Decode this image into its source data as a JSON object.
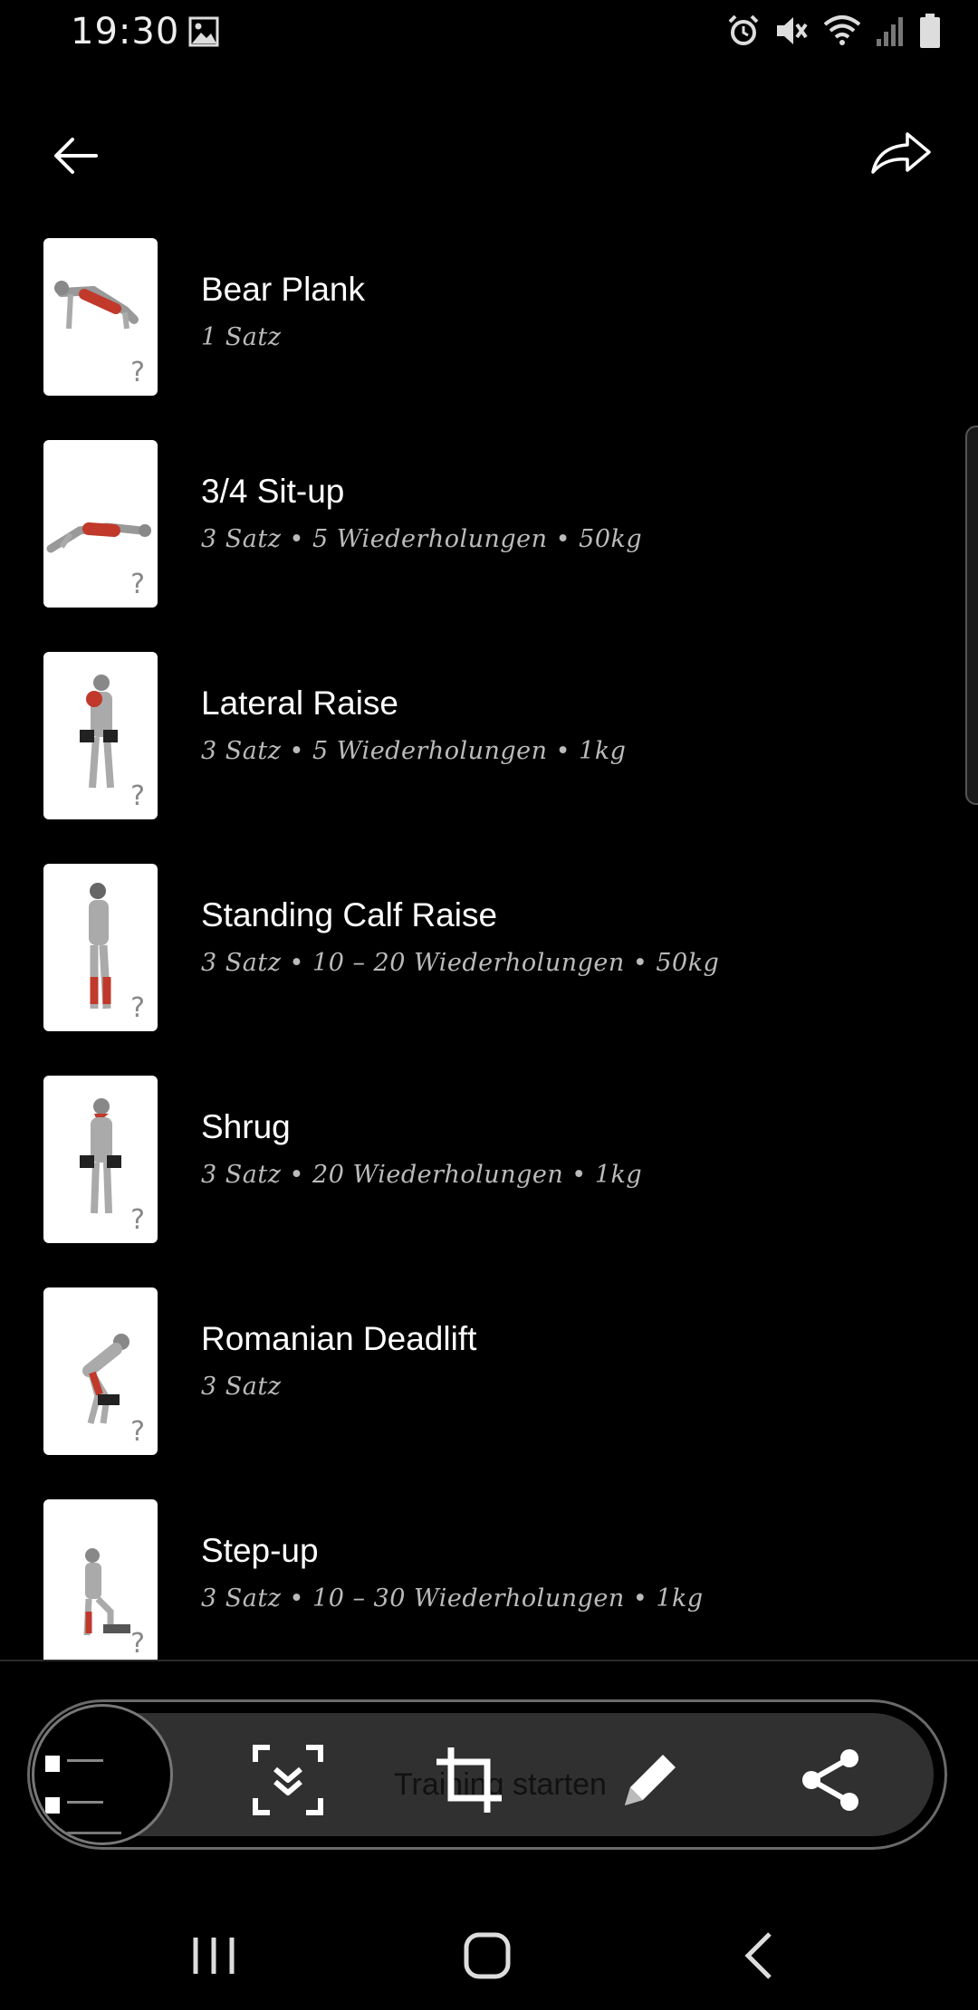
{
  "status_bar": {
    "time": "19:30",
    "icons": [
      "image-icon",
      "alarm-icon",
      "mute-icon",
      "wifi-icon",
      "signal-icon",
      "battery-icon"
    ]
  },
  "app_bar": {
    "back_icon": "arrow-left-icon",
    "share_icon": "share-forward-icon"
  },
  "exercises": [
    {
      "name": "Bear Plank",
      "details": "1 Satz"
    },
    {
      "name": "3/4 Sit-up",
      "details": "3 Satz • 5 Wiederholungen • 50kg"
    },
    {
      "name": "Lateral Raise",
      "details": "3 Satz • 5 Wiederholungen • 1kg"
    },
    {
      "name": "Standing Calf Raise",
      "details": "3 Satz • 10 – 20 Wiederholungen • 50kg"
    },
    {
      "name": "Shrug",
      "details": "3 Satz • 20 Wiederholungen • 1kg"
    },
    {
      "name": "Romanian Deadlift",
      "details": "3 Satz"
    },
    {
      "name": "Step-up",
      "details": "3 Satz • 10 – 30 Wiederholungen • 1kg"
    }
  ],
  "thumb_help": "?",
  "toolbar": {
    "start_label": "Training starten",
    "buttons": [
      "scroll-capture-icon",
      "crop-icon",
      "pencil-icon",
      "share-icon"
    ]
  },
  "nav_bar": [
    "recents-icon",
    "home-icon",
    "back-chevron-icon"
  ],
  "colors": {
    "background": "#000000",
    "accent_red": "#c0392b",
    "toolbar_bg": "#303030"
  }
}
